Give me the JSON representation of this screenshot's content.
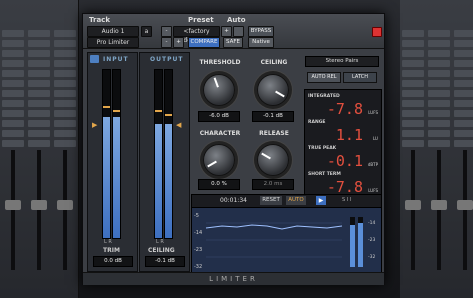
{
  "header": {
    "track_label": "Track",
    "preset_label": "Preset",
    "auto_label": "Auto",
    "track_name": "Audio 1",
    "track_sel": "a",
    "preset_name": "<factory default>",
    "plugin_name": "Pro Limiter",
    "compare": "COMPARE",
    "safe": "SAFE",
    "bypass": "BYPASS",
    "native": "Native",
    "plus": "+",
    "minus": "-"
  },
  "input": {
    "title": "INPUT",
    "trim_label": "TRIM",
    "trim_value": "0.0 dB",
    "lr": "L R",
    "level": 0.72
  },
  "output": {
    "title": "OUTPUT",
    "ceiling_label": "CEILING",
    "ceiling_value": "-0.1 dB",
    "lr": "L R",
    "level": 0.68
  },
  "knobs": {
    "threshold": {
      "label": "THRESHOLD",
      "value": "-6.0 dB"
    },
    "ceiling": {
      "label": "CEILING",
      "value": "-0.1 dB"
    },
    "character": {
      "label": "CHARACTER",
      "value": "0.0 %"
    },
    "release": {
      "label": "RELEASE",
      "value": "2.0 ms"
    }
  },
  "mode": {
    "dropdown": "Stereo Pairs",
    "auto_rel": "AUTO REL",
    "latch": "LATCH"
  },
  "loudness": {
    "integrated_label": "INTEGRATED",
    "integrated_value": "-7.8",
    "integrated_unit": "LUFS",
    "range_label": "RANGE",
    "range_value": "1.1",
    "range_unit": "LU",
    "truepeak_label": "TRUE PEAK",
    "truepeak_value": "-0.1",
    "truepeak_unit": "dBTP",
    "shortterm_label": "SHORT TERM",
    "shortterm_value": "-7.8",
    "shortterm_unit": "LUFS"
  },
  "graph": {
    "time": "00:01:34",
    "reset": "RESET",
    "auto": "AUTO",
    "play": "▶",
    "ylabels": [
      "-5",
      "-14",
      "-23",
      "-32"
    ],
    "right_labels": [
      "-14",
      "-23",
      "-32"
    ],
    "mini": "S I I"
  },
  "footer": "LIMITER",
  "colors": {
    "accent": "#e24f3e",
    "meter": "#5b8fd9",
    "highlight": "#e2a64b"
  }
}
